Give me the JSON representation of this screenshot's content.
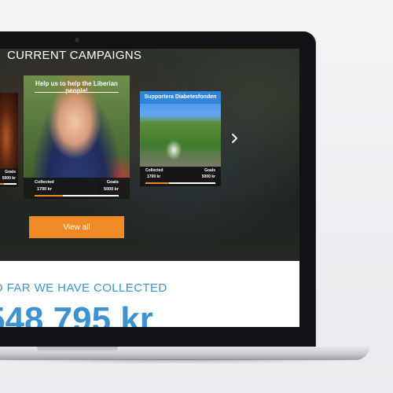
{
  "hero": {
    "title": "CURRENT CAMPAIGNS"
  },
  "campaigns": [
    {
      "title": "",
      "collected_label": "",
      "collected": "",
      "goals_label": "Goals",
      "goal": "5000 kr",
      "progress": 0.3
    },
    {
      "title": "Help us to help the Liberian people!",
      "collected_label": "Collected",
      "collected": "1700 kr",
      "goals_label": "Goals",
      "goal": "5000 kr",
      "progress": 0.34
    },
    {
      "title": "Supportera Diabetesfonden",
      "collected_label": "Collected",
      "collected": "1700 kr",
      "goals_label": "Goals",
      "goal": "5000 kr",
      "progress": 0.34
    }
  ],
  "carousel": {
    "next_icon": "chevron-right-icon"
  },
  "actions": {
    "view_all": "View all"
  },
  "totals": {
    "label": "O FAR WE HAVE COLLECTED",
    "amount": "548 795 kr"
  },
  "colors": {
    "accent_orange": "#ef8a24",
    "accent_blue": "#3d93d1",
    "bezel": "#111215"
  }
}
